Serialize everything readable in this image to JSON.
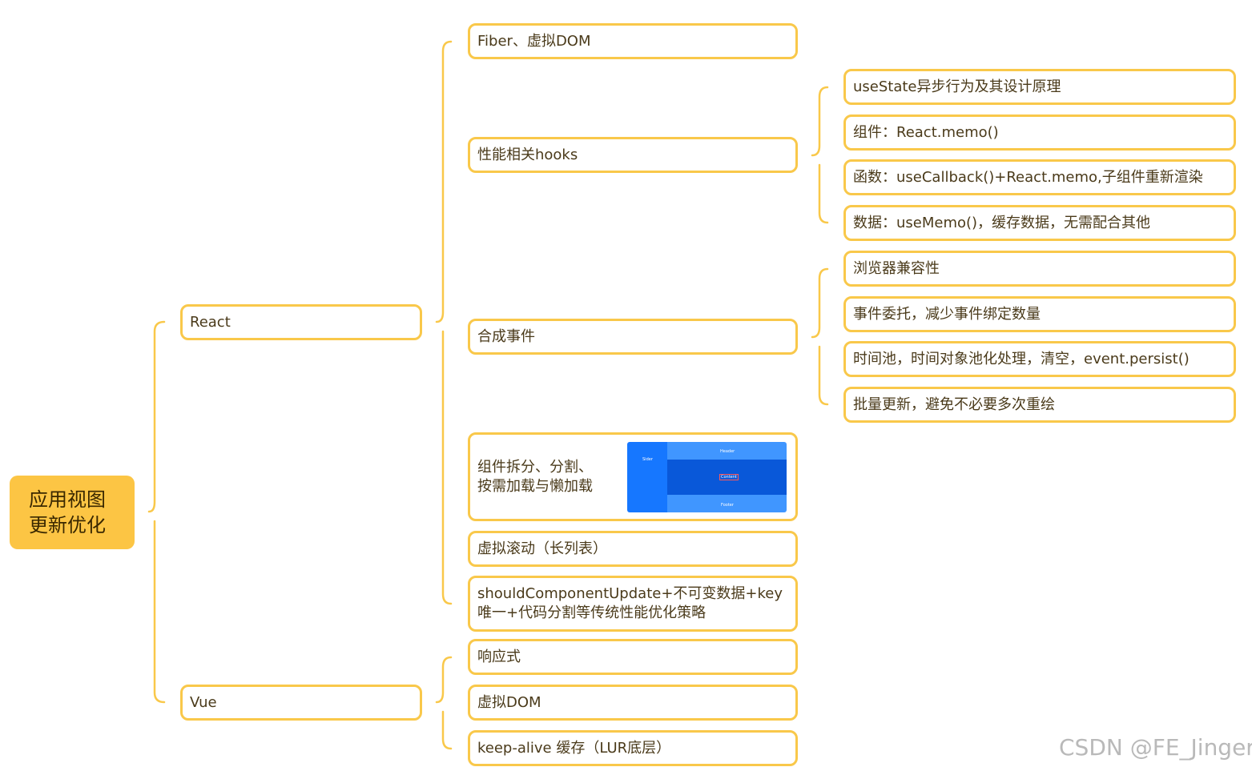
{
  "colors": {
    "root_fill": "#FCC544",
    "node_border": "#F9C84A",
    "connector": "#F9C84A",
    "node_text": "#4a3a1a"
  },
  "root": {
    "line1": "应用视图",
    "line2": "更新优化"
  },
  "react": {
    "label": "React",
    "items": {
      "fiber": "Fiber、虚拟DOM",
      "hooks": {
        "label": "性能相关hooks",
        "children": [
          "useState异步行为及其设计原理",
          "组件：React.memo()",
          "函数：useCallback()+React.memo,子组件重新渲染",
          "数据：useMemo()，缓存数据，无需配合其他"
        ]
      },
      "synthetic": {
        "label": "合成事件",
        "children": [
          "浏览器兼容性",
          "事件委托，减少事件绑定数量",
          "时间池，时间对象池化处理，清空，event.persist()",
          "批量更新，避免不必要多次重绘"
        ]
      },
      "split": {
        "line1": "组件拆分、分割、",
        "line2": "按需加载与懒加载",
        "image": {
          "sider": "Sider",
          "header": "Header",
          "content": "Content",
          "footer": "Footer"
        }
      },
      "virtual_scroll": "虚拟滚动（长列表）",
      "scu": {
        "line1": "shouldComponentUpdate+不可变数据+key",
        "line2": "唯一+代码分割等传统性能优化策略"
      }
    }
  },
  "vue": {
    "label": "Vue",
    "children": [
      "响应式",
      "虚拟DOM",
      "keep-alive 缓存（LUR底层）"
    ]
  },
  "watermark": "CSDN @FE_Jinger"
}
